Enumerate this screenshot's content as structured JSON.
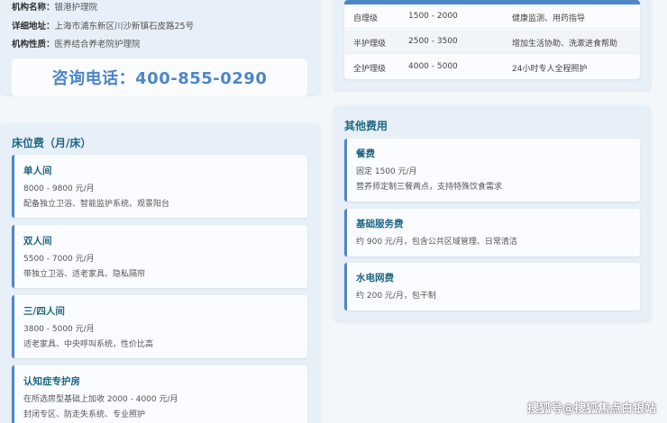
{
  "institution": {
    "name_label": "机构名称：",
    "name_value": "银港护理院",
    "address_label": "详细地址：",
    "address_value": "上海市浦东新区川沙新镇石皮路25号",
    "nature_label": "机构性质：",
    "nature_value": "医养结合养老院护理院",
    "phone": "咨询电话：400-855-0290"
  },
  "care_table": {
    "rows": [
      {
        "level": "自理级",
        "price": "1500 - 2000",
        "desc": "健康监测、用药指导"
      },
      {
        "level": "半护理级",
        "price": "2500 - 3500",
        "desc": "增加生活协助、洗漱进食帮助"
      },
      {
        "level": "全护理级",
        "price": "4000 - 5000",
        "desc": "24小时专人全程照护"
      }
    ]
  },
  "bed": {
    "title": "床位费（月/床）",
    "cards": [
      {
        "title": "单人间",
        "price": "8000 - 9800 元/月",
        "desc": "配备独立卫浴、智能监护系统、观景阳台"
      },
      {
        "title": "双人间",
        "price": "5500 - 7000 元/月",
        "desc": "带独立卫浴、适老家具、隐私隔帘"
      },
      {
        "title": "三/四人间",
        "price": "3800 - 5000 元/月",
        "desc": "适老家具、中央呼叫系统，性价比高"
      },
      {
        "title": "认知症专护房",
        "price": "在所选房型基础上加收 2000 - 4000 元/月",
        "desc": "封闭专区、防走失系统、专业照护"
      }
    ]
  },
  "other": {
    "title": "其他费用",
    "cards": [
      {
        "title": "餐费",
        "price": "固定 1500 元/月",
        "desc": "营养师定制三餐两点，支持特殊饮食需求"
      },
      {
        "title": "基础服务费",
        "price": "约 900 元/月，包含公共区域管理、日常清洁"
      },
      {
        "title": "水电网费",
        "price": "约 200 元/月，包干制"
      }
    ]
  },
  "watermark": "搜狐号@搜狐焦点白银站"
}
